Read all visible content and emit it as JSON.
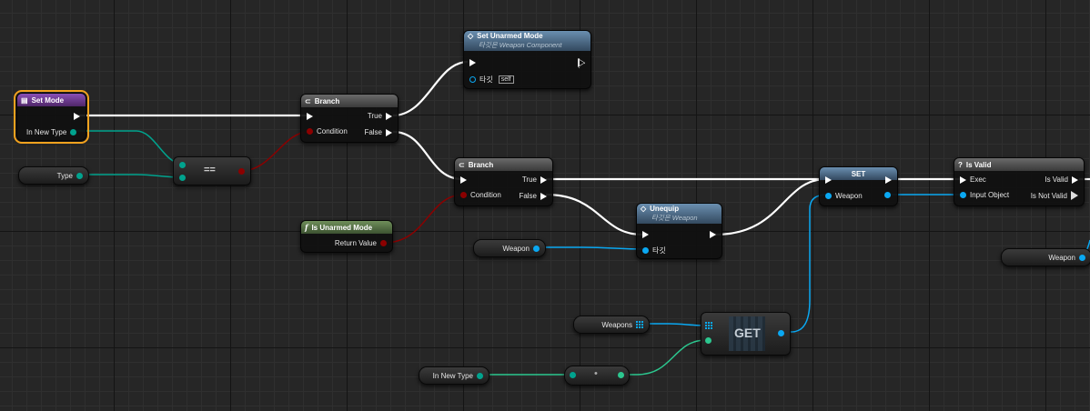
{
  "colors": {
    "exec": "#ffffff",
    "bool": "#8b0000",
    "enum": "#00a38e",
    "object": "#0aa8f2",
    "byte": "#2cc78f",
    "selected": "#f2a21e"
  },
  "nodes": {
    "set_mode": {
      "title": "Set Mode",
      "param": "In New Type"
    },
    "type_var": {
      "label": "Type"
    },
    "equals": {
      "label": "=="
    },
    "branch1": {
      "title": "Branch",
      "condition": "Condition",
      "true_label": "True",
      "false_label": "False"
    },
    "set_unarmed": {
      "title": "Set Unarmed Mode",
      "target_sub": "타깃은 Weapon Component",
      "target_label": "타깃",
      "self_label": "self"
    },
    "branch2": {
      "title": "Branch",
      "condition": "Condition",
      "true_label": "True",
      "false_label": "False"
    },
    "is_unarmed": {
      "title": "Is Unarmed Mode",
      "return_label": "Return Value"
    },
    "unequip": {
      "title": "Unequip",
      "target_sub": "타깃은 Weapon",
      "target_label": "타깃"
    },
    "weapon_var1": {
      "label": "Weapon"
    },
    "set_node": {
      "title": "SET",
      "pin_label": "Weapon"
    },
    "is_valid": {
      "title": "Is Valid",
      "exec_label": "Exec",
      "input_label": "Input Object",
      "valid_label": "Is Valid",
      "not_valid_label": "Is Not Valid"
    },
    "weapon_var2": {
      "label": "Weapon"
    },
    "weapons_var": {
      "label": "Weapons"
    },
    "get_node": {
      "label": "GET"
    },
    "in_new_type_var": {
      "label": "In New Type"
    },
    "reroute_dot": {
      "label": "•"
    }
  },
  "icons": {
    "branch": "branch-icon",
    "function": "function-icon",
    "event": "event-icon",
    "question": "question-icon",
    "array": "array-grid-icon"
  }
}
